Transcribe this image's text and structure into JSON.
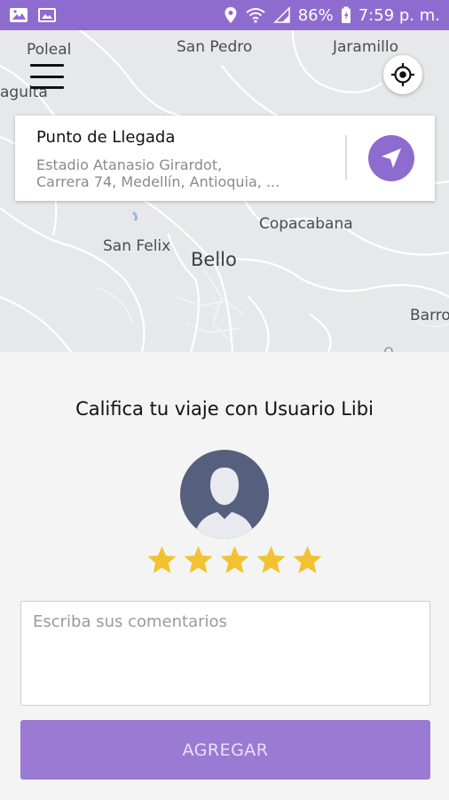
{
  "status_bar": {
    "battery": "86%",
    "time": "7:59 p. m.",
    "icons": [
      "photo-icon",
      "gallery-icon",
      "location-pin-icon",
      "wifi-icon",
      "signal-icon",
      "battery-icon"
    ]
  },
  "map": {
    "labels": {
      "poleal": "Poleal",
      "san_pedro": "San Pedro",
      "jaramillo": "Jaramillo",
      "aguita": "aguita",
      "copacabana": "Copacabana",
      "san_felix": "San Felix",
      "bello": "Bello",
      "barro": "Barro"
    }
  },
  "destination": {
    "title": "Punto de Llegada",
    "address_line1": "Estadio Atanasio Girardot,",
    "address_line2": "Carrera 74, Medellín, Antioquia, ..."
  },
  "rating": {
    "title": "Califica tu viaje con Usuario Libi",
    "stars": 5,
    "max_stars": 5,
    "comment_placeholder": "Escriba sus comentarios",
    "comment_value": "",
    "submit_label": "AGREGAR"
  },
  "colors": {
    "brand": "#8e6ccf",
    "button": "#9b7ad3",
    "star": "#f2c230",
    "avatar_bg": "#56607e"
  }
}
